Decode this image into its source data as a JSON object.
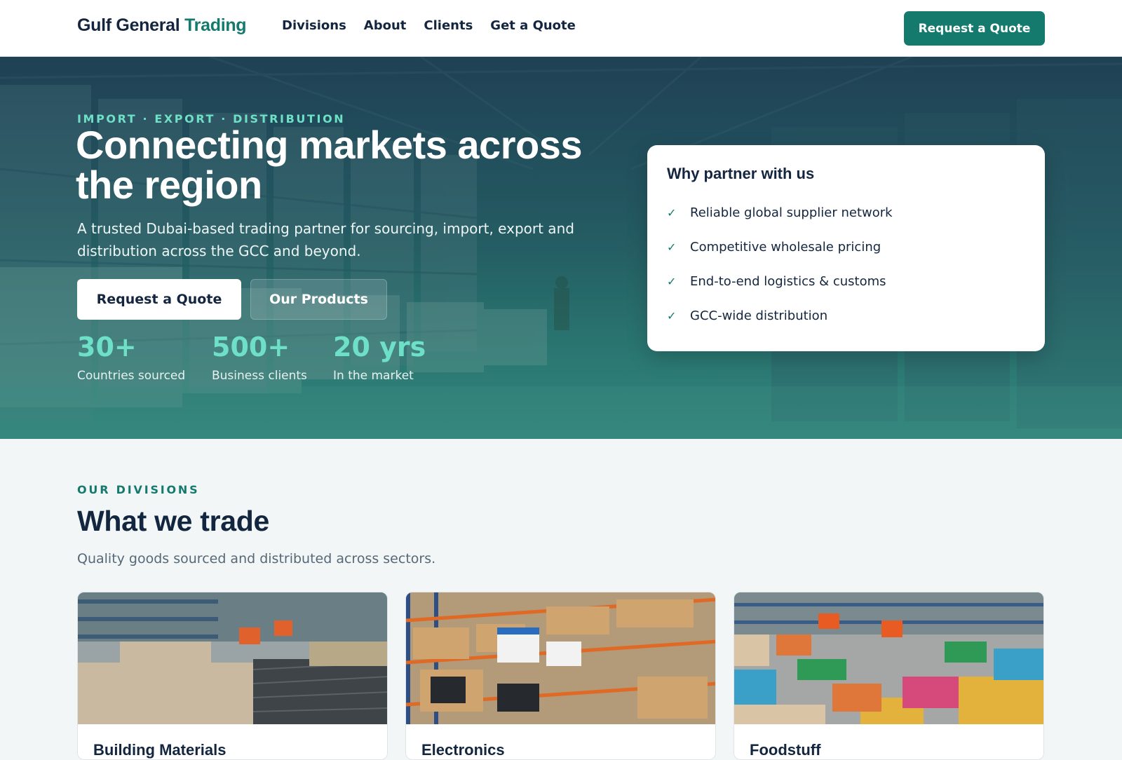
{
  "header": {
    "logo": {
      "primary": "Gulf General",
      "accent": "Trading"
    },
    "nav": [
      {
        "label": "Divisions"
      },
      {
        "label": "About"
      },
      {
        "label": "Clients"
      },
      {
        "label": "Get a Quote"
      }
    ],
    "cta_label": "Request a Quote"
  },
  "hero": {
    "eyebrow": "IMPORT · EXPORT · DISTRIBUTION",
    "title": "Connecting markets across the region",
    "subtitle": "A trusted Dubai-based trading partner for sourcing, import, export and distribution across the GCC and beyond.",
    "primary_button": "Request a Quote",
    "secondary_button": "Our Products",
    "stats": [
      {
        "value": "30+",
        "label": "Countries sourced"
      },
      {
        "value": "500+",
        "label": "Business clients"
      },
      {
        "value": "20 yrs",
        "label": "In the market"
      }
    ]
  },
  "why": {
    "title": "Why partner with us",
    "items": [
      "Reliable global supplier network",
      "Competitive wholesale pricing",
      "End-to-end logistics & customs",
      "GCC-wide distribution"
    ]
  },
  "divisions": {
    "eyebrow": "OUR DIVISIONS",
    "title": "What we trade",
    "subtitle": "Quality goods sourced and distributed across sectors.",
    "cards": [
      {
        "name": "Building Materials"
      },
      {
        "name": "Electronics"
      },
      {
        "name": "Foodstuff"
      }
    ]
  },
  "colors": {
    "brand": "#157a6e",
    "accent_light": "#6fe0c8",
    "navy": "#14263f"
  }
}
